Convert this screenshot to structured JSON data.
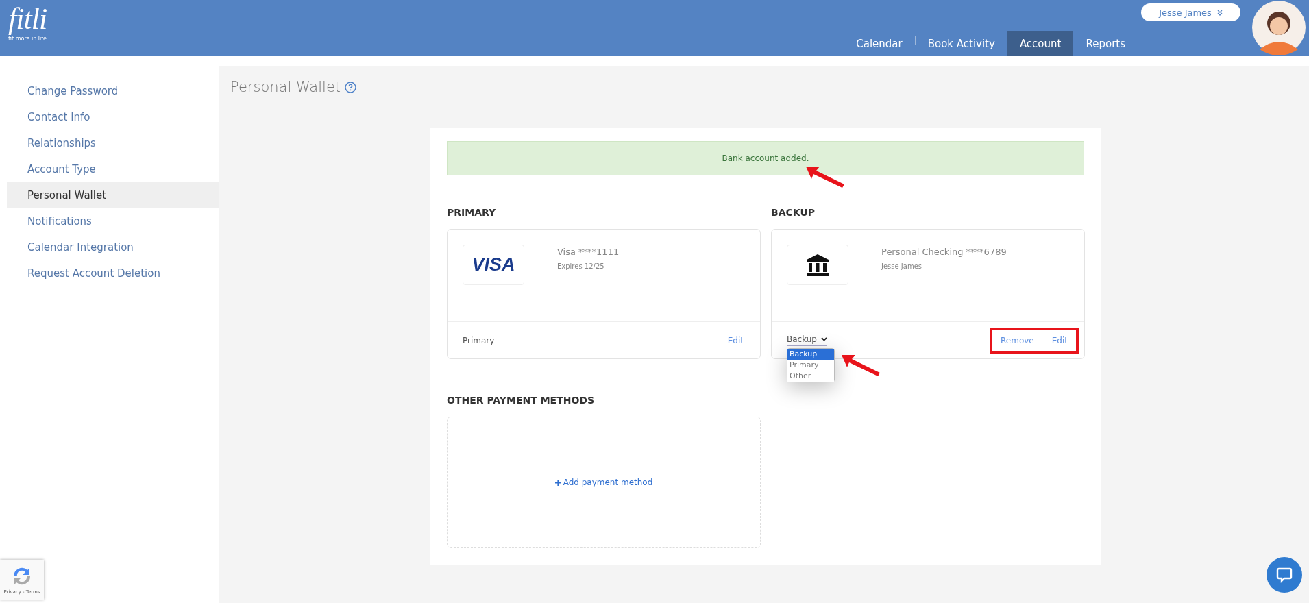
{
  "header": {
    "logo": "fitli",
    "tagline": "fit more in life",
    "user": "Jesse James",
    "nav": [
      {
        "label": "Calendar",
        "selected": false
      },
      {
        "label": "Book Activity",
        "selected": false
      },
      {
        "label": "Account",
        "selected": true
      },
      {
        "label": "Reports",
        "selected": false
      }
    ]
  },
  "sidebar": {
    "items": [
      {
        "label": "Change Password",
        "selected": false
      },
      {
        "label": "Contact Info",
        "selected": false
      },
      {
        "label": "Relationships",
        "selected": false
      },
      {
        "label": "Account Type",
        "selected": false
      },
      {
        "label": "Personal Wallet",
        "selected": true
      },
      {
        "label": "Notifications",
        "selected": false
      },
      {
        "label": "Calendar Integration",
        "selected": false
      },
      {
        "label": "Request Account Deletion",
        "selected": false
      }
    ]
  },
  "page": {
    "title": "Personal Wallet"
  },
  "alert": {
    "text": "Bank account added."
  },
  "sections": [
    {
      "heading": "PRIMARY",
      "card": {
        "kind": "card",
        "logo_text": "VISA",
        "name": "Visa ****1111",
        "detail": "Expires 12/25",
        "role": {
          "kind": "text",
          "label": "Primary"
        },
        "actions": [
          "Edit"
        ],
        "highlighted": false
      }
    },
    {
      "heading": "BACKUP",
      "card": {
        "kind": "bank",
        "name": "Personal Checking ****6789",
        "detail": "Jesse James",
        "role": {
          "kind": "select",
          "value": "Backup",
          "expanded": true,
          "options": [
            {
              "label": "Backup",
              "selected": true
            },
            {
              "label": "Primary",
              "selected": false
            },
            {
              "label": "Other",
              "selected": false
            }
          ]
        },
        "actions": [
          "Remove",
          "Edit"
        ],
        "highlighted": true
      }
    }
  ],
  "other": {
    "heading": "OTHER PAYMENT METHODS",
    "add": "Add payment method"
  },
  "recaptcha": {
    "text": "Privacy - Terms"
  }
}
